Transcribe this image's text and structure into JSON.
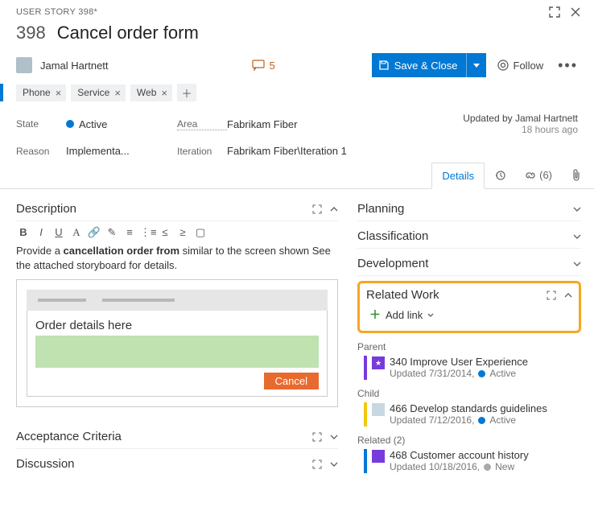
{
  "header": {
    "breadcrumb": "USER STORY 398*",
    "id": "398",
    "title": "Cancel order form"
  },
  "cmd": {
    "assignee": "Jamal Hartnett",
    "comment_count": "5",
    "save_label": "Save & Close",
    "follow_label": "Follow"
  },
  "tags": [
    "Phone",
    "Service",
    "Web"
  ],
  "fields": {
    "state_label": "State",
    "state_value": "Active",
    "reason_label": "Reason",
    "reason_value": "Implementa...",
    "area_label": "Area",
    "area_value": "Fabrikam Fiber",
    "iteration_label": "Iteration",
    "iteration_value": "Fabrikam Fiber\\Iteration 1"
  },
  "updated": {
    "by": "Updated by Jamal Hartnett",
    "ago": "18 hours ago"
  },
  "tabs": {
    "details": "Details",
    "links_count": "(6)"
  },
  "left": {
    "description_label": "Description",
    "desc_pre": "Provide a ",
    "desc_bold": "cancellation order from",
    "desc_post": " similar to the screen shown See the attached storyboard for details.",
    "mock_label": "Order details here",
    "mock_cancel": "Cancel",
    "acceptance_label": "Acceptance Criteria",
    "discussion_label": "Discussion"
  },
  "right": {
    "planning": "Planning",
    "classification": "Classification",
    "development": "Development",
    "related_work": "Related Work",
    "add_link": "Add link",
    "groups": [
      {
        "title": "Parent",
        "items": [
          {
            "stripe": "#773adc",
            "ico_bg": "#773adc",
            "ico": "★",
            "id": "340",
            "name": "Improve User Experience",
            "sub": "Updated 7/31/2014,",
            "state": "Active",
            "state_dot": "blue"
          }
        ]
      },
      {
        "title": "Child",
        "items": [
          {
            "stripe": "#f2c80f",
            "ico_bg": "#c8d8e0",
            "ico": "",
            "id": "466",
            "name": "Develop standards guidelines",
            "sub": "Updated 7/12/2016,",
            "state": "Active",
            "state_dot": "blue"
          }
        ]
      },
      {
        "title": "Related (2)",
        "items": [
          {
            "stripe": "#0078d4",
            "ico_bg": "#773adc",
            "ico": "",
            "id": "468",
            "name": "Customer account history",
            "sub": "Updated 10/18/2016,",
            "state": "New",
            "state_dot": "grey"
          }
        ]
      }
    ]
  }
}
